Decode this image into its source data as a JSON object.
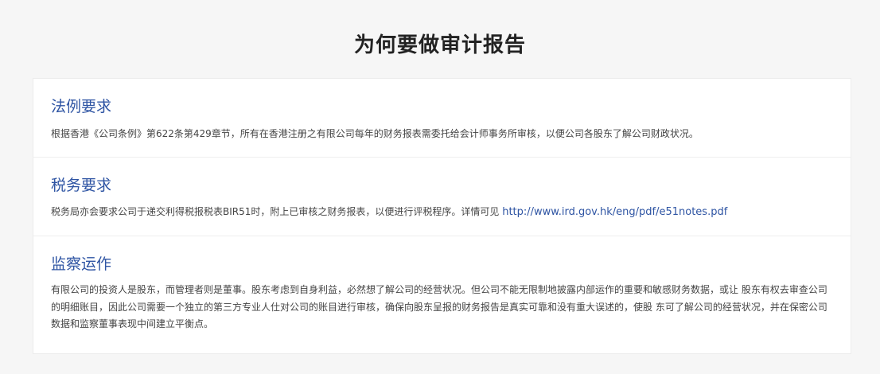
{
  "page": {
    "title": "为何要做审计报告"
  },
  "sections": [
    {
      "heading": "法例要求",
      "body": "根据香港《公司条例》第622条第429章节，所有在香港注册之有限公司每年的财务报表需委托给会计师事务所审核，以便公司各股东了解公司财政状况。"
    },
    {
      "heading": "税务要求",
      "body": "税务局亦会要求公司于递交利得税报税表BIR51时，附上已审核之财务报表，以便进行评税程序。详情可见 ",
      "link_text": "http://www.ird.gov.hk/eng/pdf/e51notes.pdf"
    },
    {
      "heading": "监察运作",
      "body": "有限公司的投资人是股东，而管理者则是董事。股东考虑到自身利益，必然想了解公司的经营状况。但公司不能无限制地披露内部运作的重要和敏感财务数据，或让 股东有权去审查公司的明细账目，因此公司需要一个独立的第三方专业人仕对公司的账目进行审核，确保向股东呈报的财务报告是真实可靠和没有重大误述的，使股 东可了解公司的经营状况，并在保密公司数据和监察董事表现中间建立平衡点。"
    }
  ],
  "colors": {
    "heading": "#2e54a3",
    "link": "#2e54a3",
    "body_text": "#444444",
    "page_background": "#f6f6f6",
    "card_background": "#ffffff"
  }
}
